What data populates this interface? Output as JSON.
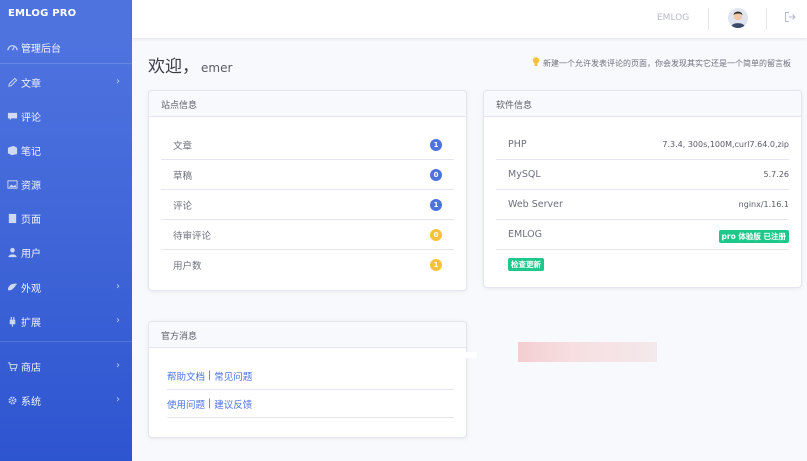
{
  "brand": "EMLOG PRO",
  "sidebar": {
    "items": [
      {
        "label": "管理后台",
        "icon": "dashboard-icon",
        "chevron": false
      },
      {
        "label": "文章",
        "icon": "pencil-icon",
        "chevron": true
      },
      {
        "label": "评论",
        "icon": "comment-icon",
        "chevron": false
      },
      {
        "label": "笔记",
        "icon": "note-icon",
        "chevron": false
      },
      {
        "label": "资源",
        "icon": "image-icon",
        "chevron": false
      },
      {
        "label": "页面",
        "icon": "page-icon",
        "chevron": false
      },
      {
        "label": "用户",
        "icon": "user-icon",
        "chevron": false
      },
      {
        "label": "外观",
        "icon": "palette-icon",
        "chevron": true
      },
      {
        "label": "扩展",
        "icon": "plugin-icon",
        "chevron": true
      },
      {
        "label": "商店",
        "icon": "store-icon",
        "chevron": true
      },
      {
        "label": "系统",
        "icon": "gear-icon",
        "chevron": true
      }
    ]
  },
  "topbar": {
    "site_label": "EMLOG"
  },
  "welcome": {
    "greeting": "欢迎，",
    "username": "emer",
    "tip": "新建一个允许发表评论的页面，你会发现其实它还是一个简单的留言板"
  },
  "site_info": {
    "title": "站点信息",
    "rows": [
      {
        "label": "文章",
        "count": "1",
        "color": "#4e73df"
      },
      {
        "label": "草稿",
        "count": "0",
        "color": "#4e73df"
      },
      {
        "label": "评论",
        "count": "1",
        "color": "#4e73df"
      },
      {
        "label": "待审评论",
        "count": "0",
        "color": "#f6c23e"
      },
      {
        "label": "用户数",
        "count": "1",
        "color": "#f6c23e"
      }
    ]
  },
  "software_info": {
    "title": "软件信息",
    "rows": [
      {
        "label": "PHP",
        "value": "7.3.4, 300s,100M,curl7.64.0,zip"
      },
      {
        "label": "MySQL",
        "value": "5.7.26"
      },
      {
        "label": "Web Server",
        "value": "nginx/1.16.1"
      },
      {
        "label": "EMLOG",
        "value": "pro 体验版 已注册"
      }
    ],
    "check_update": "检查更新"
  },
  "official_news": {
    "title": "官方消息",
    "rows": [
      {
        "left": "帮助文档",
        "right": "常见问题"
      },
      {
        "left": "使用问题",
        "right": "建议反馈"
      }
    ]
  }
}
